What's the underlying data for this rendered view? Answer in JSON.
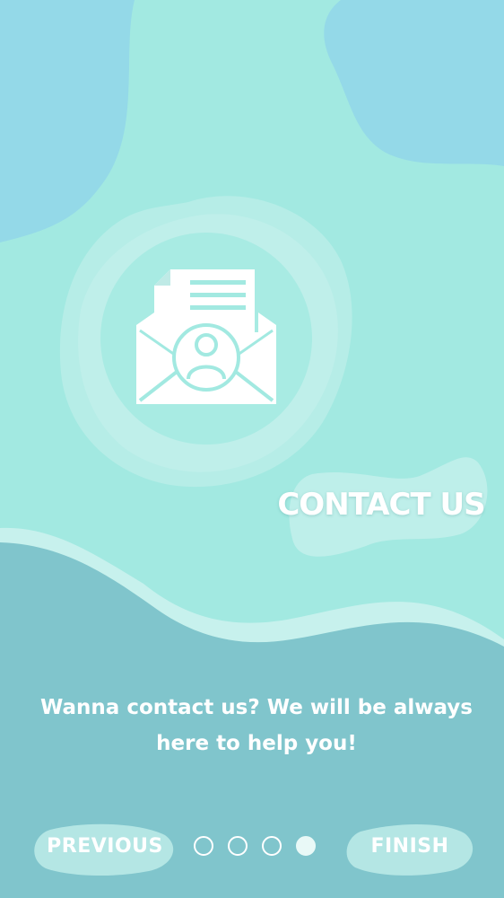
{
  "onboarding": {
    "title": "CONTACT US",
    "message_line1": "Wanna contact us? We will be always",
    "message_line2": "here to help you!",
    "icon": "envelope-letter-user-icon"
  },
  "navigation": {
    "previous_label": "PREVIOUS",
    "finish_label": "FINISH",
    "page_count": 4,
    "current_page": 4
  },
  "colors": {
    "background": "#a2e9e1",
    "top_wave": "#94d9e8",
    "bottom_area": "#80c5cc",
    "accent_white": "#ffffff"
  }
}
